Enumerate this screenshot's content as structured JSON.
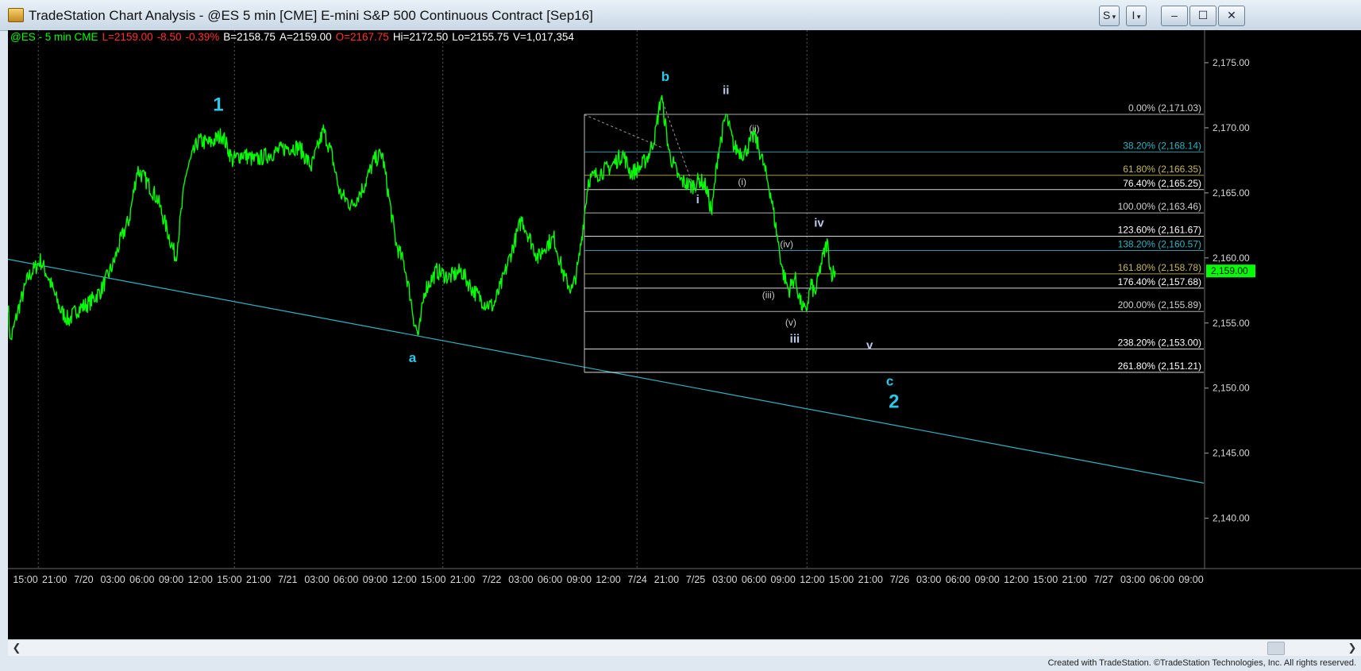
{
  "window": {
    "title": "TradeStation Chart Analysis - @ES 5 min [CME] E-mini S&P 500 Continuous Contract [Sep16]",
    "buttons": {
      "s_menu": "S",
      "i_menu": "I",
      "minimize": "‒",
      "maximize": "☐",
      "close": "✕"
    },
    "footer": "Created with TradeStation. ©TradeStation Technologies, Inc. All rights reserved."
  },
  "info_bar": [
    {
      "text": "@ES - 5 min  CME",
      "color": "#00ff00"
    },
    {
      "text": "L=2159.00",
      "color": "#ff3030"
    },
    {
      "text": "-8.50",
      "color": "#ff3030"
    },
    {
      "text": "-0.39%",
      "color": "#ff3030"
    },
    {
      "text": "B=2158.75",
      "color": "#ffffff"
    },
    {
      "text": "A=2159.00",
      "color": "#ffffff"
    },
    {
      "text": "O=2167.75",
      "color": "#ff3030"
    },
    {
      "text": "Hi=2172.50",
      "color": "#ffffff"
    },
    {
      "text": "Lo=2155.75",
      "color": "#ffffff"
    },
    {
      "text": "V=1,017,354",
      "color": "#ffffff"
    }
  ],
  "colors": {
    "price": "#00ff00",
    "trendline": "#2fb3c2",
    "wave_major": "#29c8e8",
    "wave_minor": "#b8c8e8",
    "axis_bg": "#000000",
    "fib": "#d0d0d0"
  },
  "chart_data": {
    "type": "line",
    "symbol": "@ES",
    "interval": "5 min",
    "ylim": [
      2136.5,
      2177.5
    ],
    "y_ticks": [
      "2,140.00",
      "2,145.00",
      "2,150.00",
      "2,155.00",
      "2,160.00",
      "2,165.00",
      "2,170.00",
      "2,175.00"
    ],
    "x_tick_labels": [
      "15:00",
      "21:00",
      "7/20",
      "03:00",
      "06:00",
      "09:00",
      "12:00",
      "15:00",
      "21:00",
      "7/21",
      "03:00",
      "06:00",
      "09:00",
      "12:00",
      "15:00",
      "21:00",
      "7/22",
      "03:00",
      "06:00",
      "09:00",
      "12:00",
      "7/24",
      "21:00",
      "7/25",
      "03:00",
      "06:00",
      "09:00",
      "12:00",
      "15:00",
      "21:00",
      "7/26",
      "03:00",
      "06:00",
      "09:00",
      "12:00",
      "15:00",
      "21:00",
      "7/27",
      "03:00",
      "06:00",
      "09:00"
    ],
    "last_price": "2,159.00",
    "price_path": [
      [
        0,
        2156.5
      ],
      [
        0.06,
        2153.5
      ],
      [
        0.25,
        2156.0
      ],
      [
        0.5,
        2158.5
      ],
      [
        0.8,
        2159.8
      ],
      [
        1.0,
        2158.5
      ],
      [
        1.3,
        2156.0
      ],
      [
        1.5,
        2155.2
      ],
      [
        1.7,
        2156.0
      ],
      [
        2.0,
        2156.5
      ],
      [
        2.3,
        2157.5
      ],
      [
        2.6,
        2159.5
      ],
      [
        2.8,
        2161.5
      ],
      [
        3.0,
        2163.0
      ],
      [
        3.2,
        2166.8
      ],
      [
        3.4,
        2166.0
      ],
      [
        3.7,
        2164.5
      ],
      [
        3.9,
        2162.5
      ],
      [
        4.15,
        2160.0
      ],
      [
        4.4,
        2166.5
      ],
      [
        4.7,
        2169.0
      ],
      [
        5.0,
        2168.8
      ],
      [
        5.3,
        2169.5
      ],
      [
        5.55,
        2167.5
      ],
      [
        5.8,
        2168.0
      ],
      [
        6.1,
        2167.5
      ],
      [
        6.5,
        2168.0
      ],
      [
        6.9,
        2168.5
      ],
      [
        7.2,
        2168.5
      ],
      [
        7.5,
        2167.0
      ],
      [
        7.8,
        2169.8
      ],
      [
        8.0,
        2168.0
      ],
      [
        8.2,
        2165.0
      ],
      [
        8.5,
        2164.0
      ],
      [
        8.8,
        2165.5
      ],
      [
        9.05,
        2167.5
      ],
      [
        9.25,
        2168.0
      ],
      [
        9.4,
        2165.0
      ],
      [
        9.6,
        2161.0
      ],
      [
        9.8,
        2159.5
      ],
      [
        9.95,
        2157.0
      ],
      [
        10.05,
        2155.0
      ],
      [
        10.15,
        2154.0
      ],
      [
        10.3,
        2157.5
      ],
      [
        10.6,
        2159.0
      ],
      [
        10.9,
        2158.5
      ],
      [
        11.2,
        2159.0
      ],
      [
        11.5,
        2157.5
      ],
      [
        11.8,
        2156.5
      ],
      [
        12.0,
        2156.3
      ],
      [
        12.2,
        2158.0
      ],
      [
        12.5,
        2161.0
      ],
      [
        12.7,
        2163.0
      ],
      [
        12.9,
        2161.5
      ],
      [
        13.1,
        2160.0
      ],
      [
        13.3,
        2161.0
      ],
      [
        13.5,
        2161.5
      ],
      [
        13.75,
        2158.5
      ],
      [
        13.95,
        2157.5
      ],
      [
        14.1,
        2159.5
      ],
      [
        14.2,
        2162.0
      ],
      [
        14.35,
        2166.0
      ],
      [
        14.6,
        2166.5
      ],
      [
        14.9,
        2167.0
      ],
      [
        15.2,
        2168.0
      ],
      [
        15.4,
        2166.5
      ],
      [
        15.65,
        2167.0
      ],
      [
        15.85,
        2168.0
      ],
      [
        16.0,
        2169.5
      ],
      [
        16.15,
        2172.5
      ],
      [
        16.35,
        2168.0
      ],
      [
        16.6,
        2166.0
      ],
      [
        16.9,
        2165.5
      ],
      [
        17.1,
        2166.0
      ],
      [
        17.25,
        2165.5
      ],
      [
        17.4,
        2163.5
      ],
      [
        17.55,
        2168.0
      ],
      [
        17.75,
        2171.0
      ],
      [
        17.95,
        2168.5
      ],
      [
        18.2,
        2168.0
      ],
      [
        18.45,
        2169.5
      ],
      [
        18.65,
        2167.5
      ],
      [
        18.85,
        2165.0
      ],
      [
        19.0,
        2162.0
      ],
      [
        19.15,
        2159.0
      ],
      [
        19.3,
        2157.5
      ],
      [
        19.45,
        2158.5
      ],
      [
        19.6,
        2156.5
      ],
      [
        19.72,
        2155.75
      ],
      [
        19.85,
        2158.0
      ],
      [
        19.95,
        2157.2
      ],
      [
        20.1,
        2159.5
      ],
      [
        20.25,
        2161.2
      ],
      [
        20.35,
        2158.8
      ],
      [
        20.45,
        2159.0
      ]
    ],
    "trendline": {
      "from": [
        0,
        2159.9
      ],
      "to": [
        29.56,
        2142.7
      ]
    },
    "fib_box": {
      "x_start": 14.25,
      "x_end": 29.56,
      "y_top": 2171.03,
      "y_bottom": 2151.21
    },
    "fib_levels": [
      {
        "label": "0.00% (2,171.03)",
        "value": 2171.03,
        "color": "#d0d0d0"
      },
      {
        "label": "38.20% (2,168.14)",
        "value": 2168.14,
        "color": "#2fb3c2"
      },
      {
        "label": "61.80% (2,166.35)",
        "value": 2166.35,
        "color": "#c8b85a"
      },
      {
        "label": "76.40% (2,165.25)",
        "value": 2165.25,
        "color": "#ffffff"
      },
      {
        "label": "100.00% (2,163.46)",
        "value": 2163.46,
        "color": "#d0d0d0"
      },
      {
        "label": "123.60% (2,161.67)",
        "value": 2161.67,
        "color": "#ffffff"
      },
      {
        "label": "138.20% (2,160.57)",
        "value": 2160.57,
        "color": "#2fb3c2"
      },
      {
        "label": "161.80% (2,158.78)",
        "value": 2158.78,
        "color": "#c8b85a"
      },
      {
        "label": "176.40% (2,157.68)",
        "value": 2157.68,
        "color": "#ffffff"
      },
      {
        "label": "200.00% (2,155.89)",
        "value": 2155.89,
        "color": "#d0d0d0"
      },
      {
        "label": "238.20% (2,153.00)",
        "value": 2153.0,
        "color": "#ffffff"
      },
      {
        "label": "261.80% (2,151.21)",
        "value": 2151.21,
        "color": "#ffffff"
      }
    ],
    "dashed_lines": [
      {
        "from": [
          14.25,
          2171.0
        ],
        "to": [
          16.15,
          2168.5
        ]
      },
      {
        "from": [
          16.15,
          2172.3
        ],
        "to": [
          17.0,
          2165.0
        ]
      }
    ],
    "vertical_separators": [
      0.75,
      5.6,
      10.75,
      15.55,
      19.75
    ],
    "wave_labels": [
      {
        "text": "1",
        "x": 5.2,
        "y": 2171.3,
        "tier": "major"
      },
      {
        "text": "a",
        "x": 10.0,
        "y": 2152.0,
        "tier": "mid"
      },
      {
        "text": "b",
        "x": 16.25,
        "y": 2173.6,
        "tier": "mid"
      },
      {
        "text": "c",
        "x": 21.8,
        "y": 2150.2,
        "tier": "mid"
      },
      {
        "text": "2",
        "x": 21.9,
        "y": 2148.5,
        "tier": "major"
      },
      {
        "text": "i",
        "x": 17.05,
        "y": 2164.2,
        "tier": "minor"
      },
      {
        "text": "ii",
        "x": 17.75,
        "y": 2172.6,
        "tier": "minor"
      },
      {
        "text": "iii",
        "x": 19.45,
        "y": 2153.5,
        "tier": "minor"
      },
      {
        "text": "iv",
        "x": 20.05,
        "y": 2162.4,
        "tier": "minor"
      },
      {
        "text": "v",
        "x": 21.3,
        "y": 2153.0,
        "tier": "minor"
      },
      {
        "text": "(i)",
        "x": 18.15,
        "y": 2165.6,
        "tier": "tiny"
      },
      {
        "text": "(ii)",
        "x": 18.45,
        "y": 2169.7,
        "tier": "tiny"
      },
      {
        "text": "(iii)",
        "x": 18.8,
        "y": 2156.9,
        "tier": "tiny"
      },
      {
        "text": "(iv)",
        "x": 19.25,
        "y": 2160.8,
        "tier": "tiny"
      },
      {
        "text": "(v)",
        "x": 19.35,
        "y": 2154.8,
        "tier": "tiny"
      }
    ],
    "grid": false,
    "legend": "none"
  }
}
